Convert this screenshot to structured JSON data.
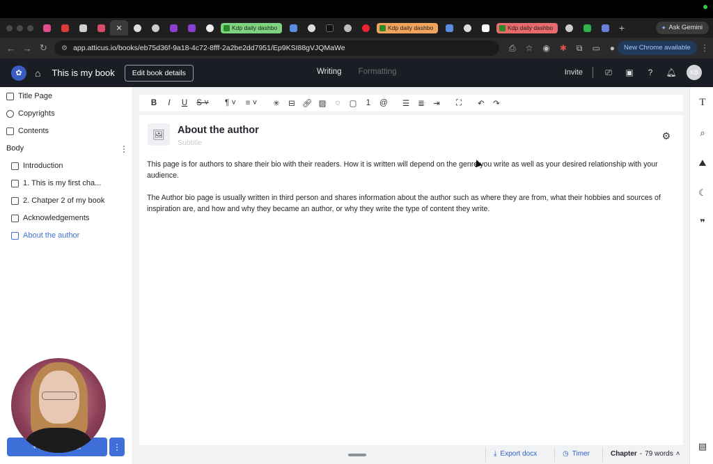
{
  "browser": {
    "tabs": [
      {
        "label": "Kdp daily dashbo",
        "color": "#7ed47e"
      },
      {
        "label": "Kdp daily dashbo",
        "color": "#f2a35c"
      },
      {
        "label": "Kdp daily dashbo",
        "color": "#e96a6a"
      }
    ],
    "gemini_label": "Ask Gemini",
    "url": "app.atticus.io/books/eb75d36f-9a18-4c72-8fff-2a2be2dd7951/Ep9KSI88gVJQMaWe",
    "new_chrome_label": "New Chrome available"
  },
  "header": {
    "book_title": "This is my book",
    "edit_details_label": "Edit book details",
    "mode_writing": "Writing",
    "mode_formatting": "Formatting",
    "invite_label": "Invite",
    "avatar_initials": "KB"
  },
  "sidebar": {
    "front_items": [
      {
        "label": "Title Page"
      },
      {
        "label": "Copyrights"
      },
      {
        "label": "Contents"
      }
    ],
    "body_label": "Body",
    "body_items": [
      {
        "label": "Introduction"
      },
      {
        "label": "1. This is my first cha..."
      },
      {
        "label": "2. Chatper 2 of my book"
      },
      {
        "label": "Acknowledgements"
      },
      {
        "label": "About the author"
      }
    ],
    "new_chapter_label": "+ New Chapter"
  },
  "editor": {
    "chapter_title": "About the author",
    "subtitle_placeholder": "Subtitle",
    "paragraphs": [
      "This page is for authors to share their bio with their readers. How it is written will depend on the genre you write as well as your desired relationship with your audience.",
      "The Author bio page is usually written in third person and shares information about the author such as where they are from, what their hobbies and sources of inspiration are, and how and why they became an author, or why they write the type of content they write."
    ]
  },
  "footer": {
    "export_label": "Export docx",
    "timer_label": "Timer",
    "scope_label": "Chapter",
    "word_count": "79 words"
  },
  "colors": {
    "accent": "#3f6fd8",
    "header_bg": "#1a1d23"
  }
}
